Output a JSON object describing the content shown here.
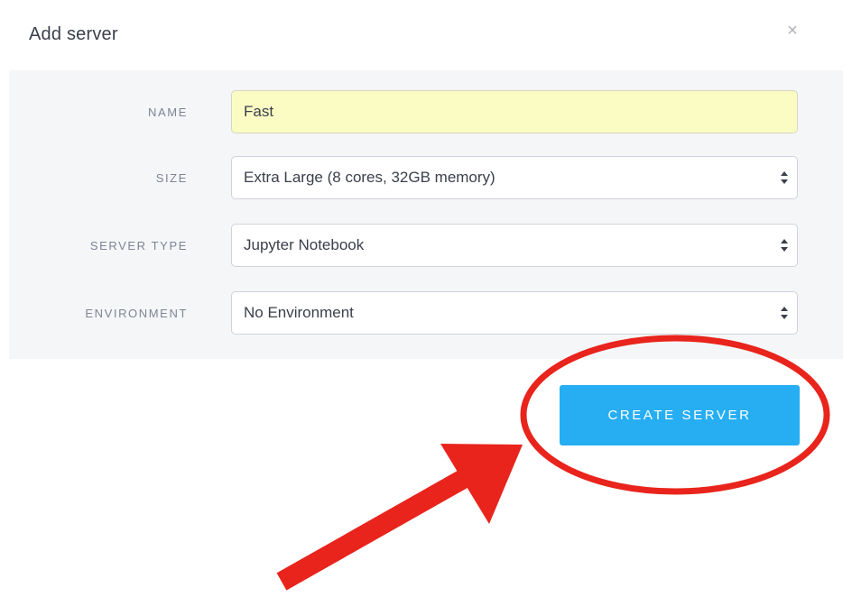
{
  "dialog": {
    "title": "Add server",
    "close_glyph": "×"
  },
  "form": {
    "name": {
      "label": "NAME",
      "value": "Fast"
    },
    "size": {
      "label": "SIZE",
      "value": "Extra Large (8 cores, 32GB memory)"
    },
    "server_type": {
      "label": "SERVER TYPE",
      "value": "Jupyter Notebook"
    },
    "environment": {
      "label": "ENVIRONMENT",
      "value": "No Environment"
    }
  },
  "actions": {
    "create_label": "CREATE SERVER"
  },
  "colors": {
    "primary_button": "#27aef2",
    "annotation": "#e8241c",
    "name_field_bg": "#fbfcc4",
    "panel_bg": "#f5f6f8"
  },
  "icons": {
    "close": "close-icon",
    "select": "select-arrows-icon",
    "annotation_circle": "red-ellipse-annotation",
    "annotation_arrow": "red-arrow-annotation"
  }
}
